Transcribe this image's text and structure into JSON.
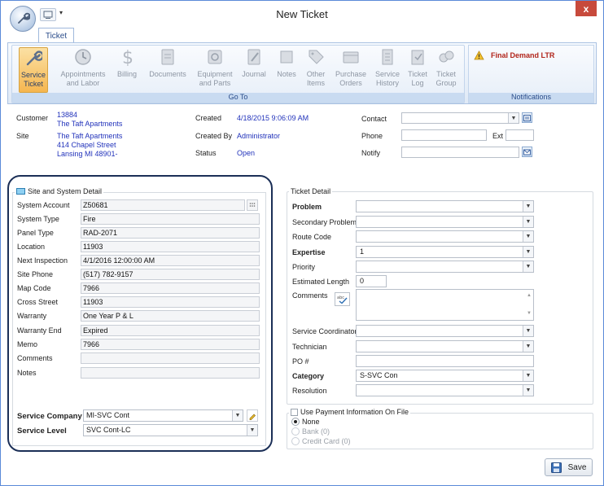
{
  "window": {
    "title": "New Ticket",
    "close_label": "x",
    "qat_dropdown": "▾"
  },
  "ribbon": {
    "tab": "Ticket",
    "go_to_label": "Go To",
    "buttons": [
      {
        "line1": "Service",
        "line2": "Ticket",
        "icon": "wrench-icon"
      },
      {
        "line1": "Appointments",
        "line2": "and Labor",
        "icon": "clock-icon"
      },
      {
        "line1": "Billing",
        "line2": "",
        "icon": "dollar-icon"
      },
      {
        "line1": "Documents",
        "line2": "",
        "icon": "document-icon"
      },
      {
        "line1": "Equipment",
        "line2": "and Parts",
        "icon": "equipment-icon"
      },
      {
        "line1": "Journal",
        "line2": "",
        "icon": "journal-icon"
      },
      {
        "line1": "Notes",
        "line2": "",
        "icon": "note-icon"
      },
      {
        "line1": "Other",
        "line2": "Items",
        "icon": "tag-icon"
      },
      {
        "line1": "Purchase",
        "line2": "Orders",
        "icon": "purchase-icon"
      },
      {
        "line1": "Service",
        "line2": "History",
        "icon": "history-icon"
      },
      {
        "line1": "Ticket",
        "line2": "Log",
        "icon": "log-icon"
      },
      {
        "line1": "Ticket",
        "line2": "Group",
        "icon": "group-icon"
      }
    ],
    "notifications_label": "Notifications",
    "notification": "Final Demand LTR"
  },
  "header": {
    "customer_label": "Customer",
    "customer_number": "13884",
    "customer_name": "The Taft Apartments",
    "site_label": "Site",
    "site_name": "The Taft Apartments",
    "site_address1": "414 Chapel Street",
    "site_address2": "Lansing MI 48901-",
    "created_label": "Created",
    "created_value": "4/18/2015 9:06:09 AM",
    "created_by_label": "Created By",
    "created_by_value": "Administrator",
    "status_label": "Status",
    "status_value": "Open",
    "contact_label": "Contact",
    "phone_label": "Phone",
    "ext_label": "Ext",
    "notify_label": "Notify"
  },
  "site_detail": {
    "title": "Site and System Detail",
    "rows": [
      {
        "label": "System Account",
        "value": "Z50681"
      },
      {
        "label": "System Type",
        "value": "Fire"
      },
      {
        "label": "Panel Type",
        "value": "RAD-2071"
      },
      {
        "label": "Location",
        "value": "11903"
      },
      {
        "label": "Next Inspection",
        "value": "4/1/2016 12:00:00 AM"
      },
      {
        "label": "Site Phone",
        "value": "(517) 782-9157"
      },
      {
        "label": "Map Code",
        "value": "7966"
      },
      {
        "label": "Cross Street",
        "value": "11903"
      },
      {
        "label": "Warranty",
        "value": "One Year P & L"
      },
      {
        "label": "Warranty End",
        "value": "Expired"
      },
      {
        "label": "Memo",
        "value": "7966"
      },
      {
        "label": "Comments",
        "value": ""
      },
      {
        "label": "Notes",
        "value": ""
      }
    ],
    "service_company_label": "Service Company",
    "service_company_value": "MI-SVC Cont",
    "service_level_label": "Service Level",
    "service_level_value": "SVC Cont-LC"
  },
  "ticket_detail": {
    "title": "Ticket Detail",
    "problem": "Problem",
    "secondary_problem": "Secondary Problem",
    "route_code": "Route Code",
    "expertise": "Expertise",
    "expertise_value": "1",
    "priority": "Priority",
    "estimated_length": "Estimated Length",
    "estimated_length_value": "0",
    "comments": "Comments",
    "service_coordinator": "Service Coordinator",
    "technician": "Technician",
    "po": "PO #",
    "category": "Category",
    "category_value": "S-SVC Con",
    "resolution": "Resolution"
  },
  "payment": {
    "title": "Use Payment Information On File",
    "options": [
      "None",
      "Bank (0)",
      "Credit Card (0)"
    ]
  },
  "save_label": "Save"
}
